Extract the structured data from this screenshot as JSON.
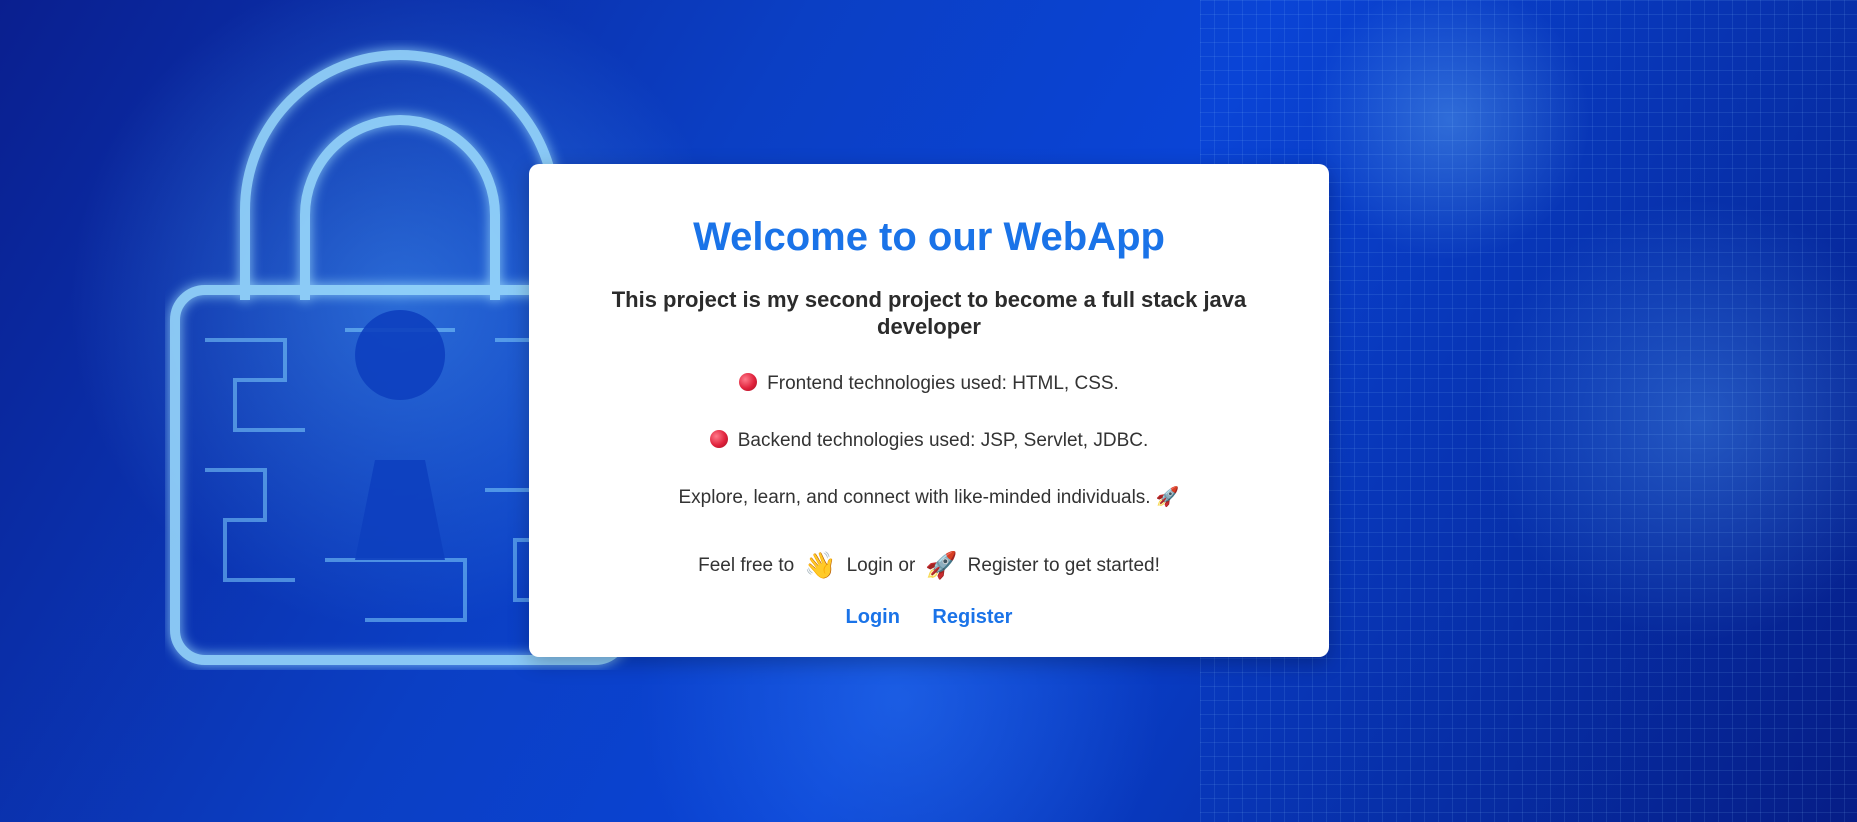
{
  "card": {
    "title": "Welcome to our WebApp",
    "subtitle": "This project is my second project to become a full stack java developer",
    "frontend": "Frontend technologies used: HTML, CSS.",
    "backend": "Backend technologies used: JSP, Servlet, JDBC.",
    "explore": "Explore, learn, and connect with like-minded individuals. 🚀",
    "cta_prefix": "Feel free to",
    "cta_login": "Login or",
    "cta_register": "Register to get started!",
    "wave_emoji": "👋",
    "rocket_emoji": "🚀"
  },
  "links": {
    "login": "Login",
    "register": "Register"
  },
  "colors": {
    "accent": "#1a73e8",
    "card_bg": "#ffffff",
    "bullet": "#e0223c"
  },
  "icons": {
    "bullet": "red-circle-icon",
    "wave": "waving-hand-icon",
    "rocket": "rocket-icon",
    "background": "padlock-circuit-background"
  }
}
